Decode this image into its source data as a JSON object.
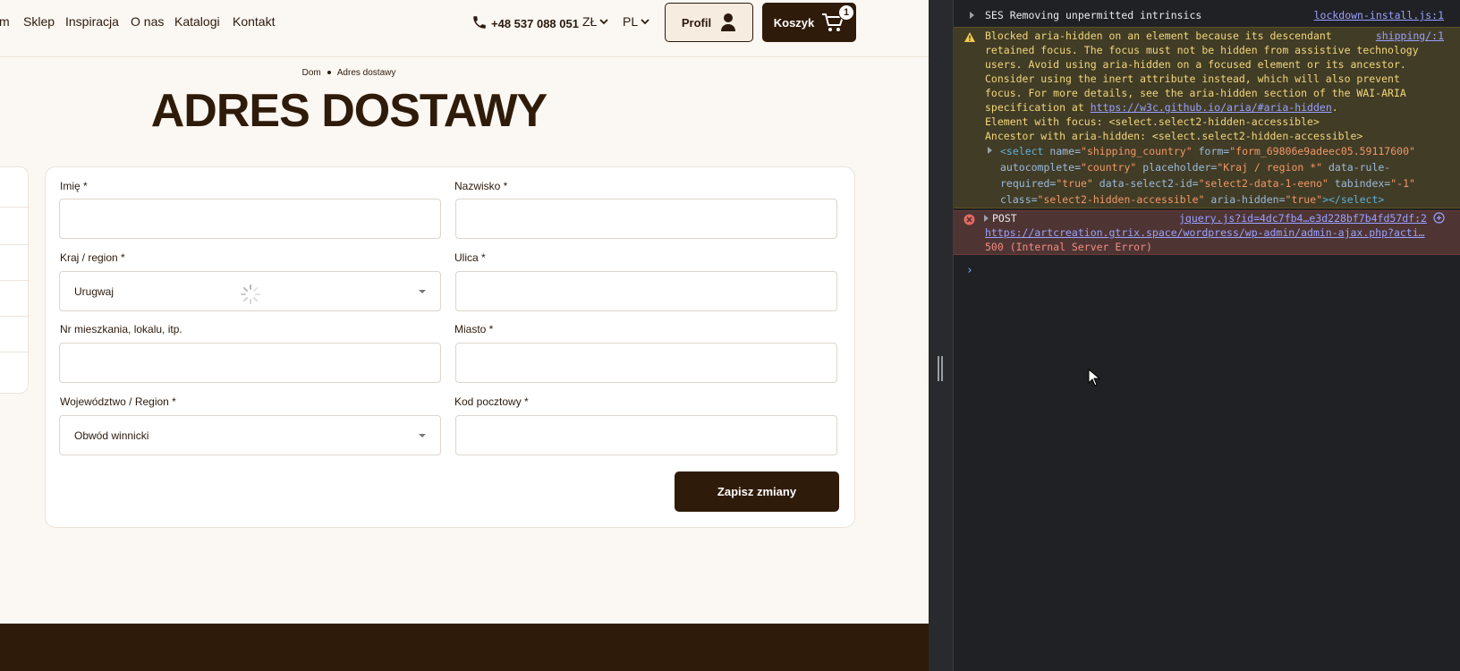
{
  "nav": {
    "links": [
      "m",
      "Sklep",
      "Inspiracja",
      "O nas",
      "Katalogi",
      "Kontakt"
    ],
    "phone": "+48 537 088 051",
    "currency": "ZŁ",
    "language": "PL",
    "profile_label": "Profil",
    "cart_label": "Koszyk",
    "cart_count": "1"
  },
  "breadcrumb": {
    "home": "Dom",
    "current": "Adres dostawy"
  },
  "page_title": "ADRES DOSTAWY",
  "form": {
    "first_name_label": "Imię *",
    "last_name_label": "Nazwisko *",
    "country_label": "Kraj / region *",
    "country_value": "Urugwaj",
    "street_label": "Ulica *",
    "apartment_label": "Nr mieszkania, lokalu, itp.",
    "city_label": "Miasto *",
    "region_label": "Województwo / Region *",
    "region_value": "Obwód winnicki",
    "postcode_label": "Kod pocztowy *",
    "save_label": "Zapisz zmiany"
  },
  "colors": {
    "brand_dark": "#2f1b09",
    "page_bg": "#fbf7f2",
    "console_bg": "#202124",
    "warn_bg": "#413c26",
    "error_bg": "#4e3534"
  },
  "console": {
    "info": {
      "text": "SES Removing unpermitted intrinsics",
      "source": "lockdown-install.js:1"
    },
    "warning": {
      "source": "shipping/:1",
      "lines": [
        "Blocked aria-hidden on an element because its descendant",
        "retained focus. The focus must not be hidden from assistive technology",
        "users. Avoid using aria-hidden on a focused element or its ancestor.",
        "Consider using the inert attribute instead, which will also prevent",
        "focus. For more details, see the aria-hidden section of the WAI-ARIA"
      ],
      "spec_prefix": "specification at",
      "spec_link": "https://w3c.github.io/aria/#aria-hidden",
      "spec_suffix": ".",
      "focus_line": "Element with focus: <select.select2-hidden-accessible>",
      "ancestor_line": "Ancestor with aria-hidden: <select.select2-hidden-accessible>",
      "el_open": "<select",
      "a1": "name=",
      "v1": "\"shipping_country\"",
      "a2": "form=",
      "v2": "\"form_69806e9adeec05.59117600\"",
      "a3": "autocomplete=",
      "v3": "\"country\"",
      "a4": "placeholder=",
      "v4": "\"Kraj / region *\"",
      "a5": "data-rule-",
      "v5_line2_attr": "required=",
      "v5": "\"true\"",
      "a6": "data-select2-id=",
      "v6": "\"select2-data-1-eeno\"",
      "a7": "tabindex=",
      "v7": "\"-1\"",
      "a8": "class=",
      "v8": "\"select2-hidden-accessible\"",
      "a9": "aria-hidden=",
      "v9": "\"true\"",
      "el_close": "></select>"
    },
    "error": {
      "method": "POST",
      "source": "jquery.js?id=4dc7fb4…e3d228bf7b4fd57df:2",
      "url": "https://artcreation.gtrix.space/wordpress/wp-admin/admin-ajax.php?acti…",
      "status": "500 (Internal Server Error)"
    },
    "prompt": "›"
  }
}
